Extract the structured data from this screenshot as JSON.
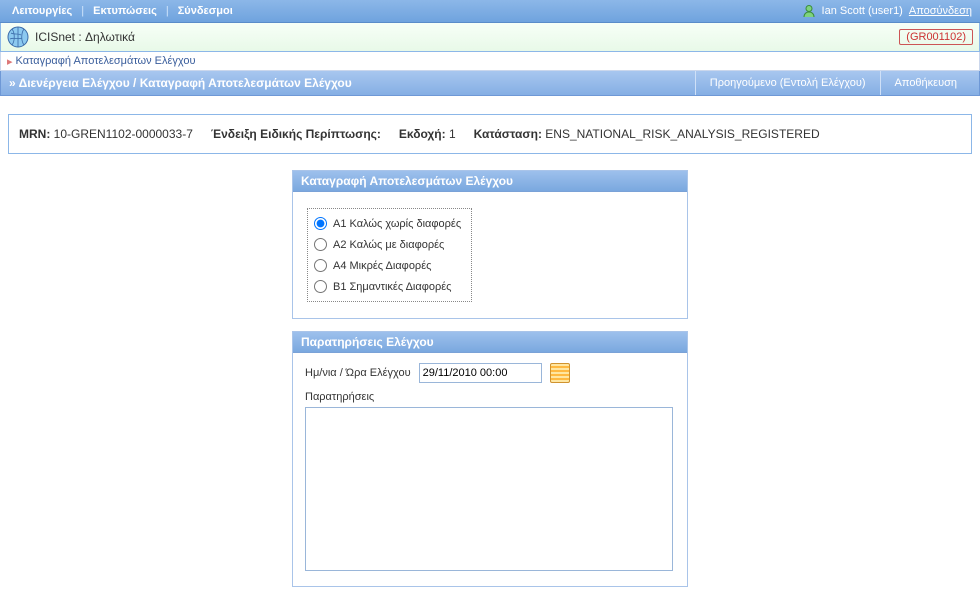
{
  "topbar": {
    "menu": [
      "Λειτουργίες",
      "Εκτυπώσεις",
      "Σύνδεσμοι"
    ],
    "user": "Ian Scott (user1)",
    "logout": "Αποσύνδεση"
  },
  "titlebar": {
    "title": "ICISnet : Δηλωτικά",
    "code": "(GR001102)"
  },
  "subnav": {
    "label": "Καταγραφή Αποτελεσμάτων Ελέγχου"
  },
  "actionbar": {
    "path": "» Διενέργεια Ελέγχου / Καταγραφή Αποτελεσμάτων Ελέγχου",
    "prev": "Προηγούμενο (Εντολή Ελέγχου)",
    "save": "Αποθήκευση"
  },
  "info": {
    "mrn_label": "MRN:",
    "mrn_value": "10-GREN1102-0000033-7",
    "special_label": "Ένδειξη Ειδικής Περίπτωσης:",
    "special_value": "",
    "version_label": "Εκδοχή:",
    "version_value": "1",
    "status_label": "Κατάσταση:",
    "status_value": "ENS_NATIONAL_RISK_ANALYSIS_REGISTERED"
  },
  "results_panel": {
    "title": "Καταγραφή Αποτελεσμάτων Ελέγχου",
    "options": [
      "A1 Καλώς χωρίς διαφορές",
      "A2 Καλώς με διαφορές",
      "A4 Μικρές Διαφορές",
      "B1 Σημαντικές Διαφορές"
    ],
    "selected": 0
  },
  "obs_panel": {
    "title": "Παρατηρήσεις Ελέγχου",
    "datetime_label": "Ημ/νια / Ώρα Ελέγχου",
    "datetime_value": "29/11/2010 00:00",
    "obs_label": "Παρατηρήσεις",
    "obs_value": ""
  }
}
